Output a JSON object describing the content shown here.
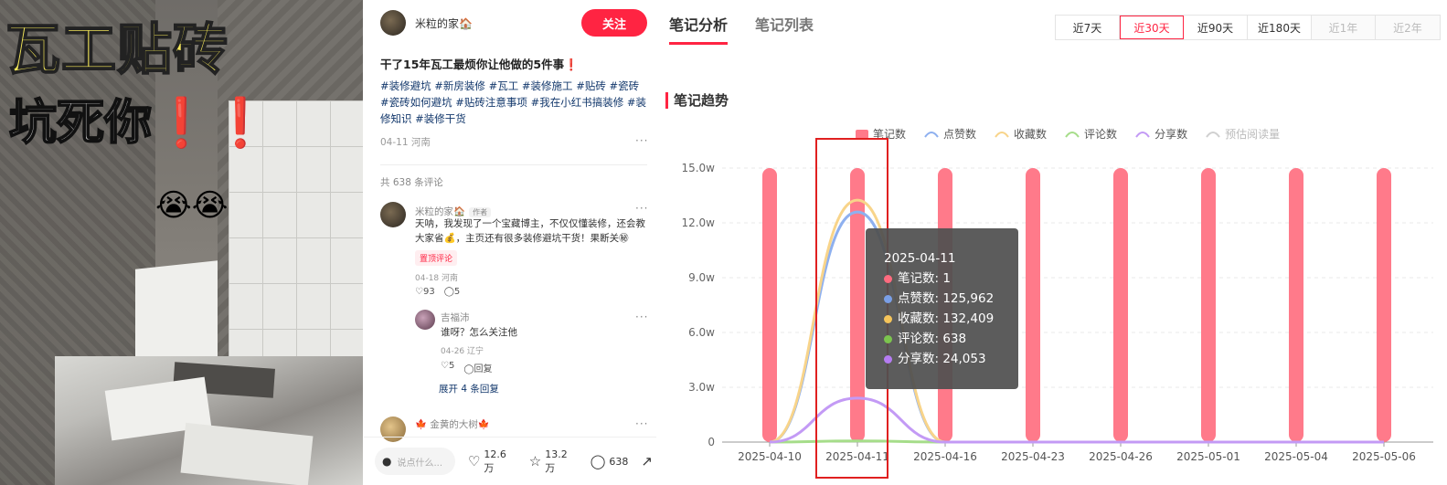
{
  "cover": {
    "title_line1": "瓦工贴砖",
    "title_line2": "坑死你",
    "title_bangs": "❗❗",
    "emoji": "😭😭"
  },
  "post": {
    "author_name": "米粒的家🏠",
    "follow_label": "关注",
    "title": "干了15年瓦工最烦你让他做的5件事❗",
    "tags": [
      "#装修避坑",
      "#新房装修",
      "#瓦工",
      "#装修施工",
      "#贴砖",
      "#瓷砖",
      "#瓷砖如何避坑",
      "#贴砖注意事项",
      "#我在小红书搞装修",
      "#装修知识",
      "#装修干货"
    ],
    "meta": "04-11 河南",
    "comment_count": "共 638 条评论",
    "comments": [
      {
        "name": "米粒的家🏠",
        "author_tag": "作者",
        "text": "天呐，我发现了一个宝藏博主，不仅仅懂装修，还会教大家省💰，主页还有很多装修避坑干货！果断关㊙",
        "pin_label": "置顶评论",
        "meta": "04-18 河南",
        "likes": "93",
        "replies": "5"
      },
      {
        "name": "吉福沛",
        "text": "谁呀？怎么关注他",
        "meta": "04-26 辽宁",
        "likes": "5",
        "reply_label": "回复"
      },
      {
        "name": "🍁 金黄的大树🍁"
      }
    ],
    "expand_label": "展开 4 条回复",
    "bottom": {
      "input_placeholder": "说点什么...",
      "likes": "12.6万",
      "collects": "13.2万",
      "comments": "638"
    }
  },
  "analytics": {
    "tabs": [
      "笔记分析",
      "笔记列表"
    ],
    "ranges": [
      "近7天",
      "近30天",
      "近90天",
      "近180天",
      "近1年",
      "近2年"
    ],
    "selected_range": "近30天",
    "section_title": "笔记趋势",
    "tooltip": {
      "date": "2025-04-11",
      "rows": [
        {
          "label": "笔记数: 1",
          "color": "#ff6b7f"
        },
        {
          "label": "点赞数: 125,962",
          "color": "#7a9fe6"
        },
        {
          "label": "收藏数: 132,409",
          "color": "#f5c45a"
        },
        {
          "label": "评论数: 638",
          "color": "#7cc44e"
        },
        {
          "label": "分享数: 24,053",
          "color": "#b57cf2"
        }
      ]
    }
  },
  "chart_data": {
    "type": "bar",
    "title": "笔记趋势",
    "categories": [
      "2025-04-10",
      "2025-04-11",
      "2025-04-16",
      "2025-04-23",
      "2025-04-26",
      "2025-05-01",
      "2025-05-04",
      "2025-05-06"
    ],
    "y_tick_labels": [
      "0",
      "3.0w",
      "6.0w",
      "9.0w",
      "12.0w",
      "15.0w"
    ],
    "ylim": [
      0,
      150000
    ],
    "grid": true,
    "legend_position": "top-center",
    "series": [
      {
        "name": "笔记数",
        "kind": "bar",
        "color": "#ff7a8a",
        "values": [
          1,
          1,
          1,
          1,
          1,
          1,
          1,
          1
        ]
      },
      {
        "name": "点赞数",
        "kind": "line",
        "color": "#8eb0ef",
        "values": [
          0,
          125962,
          0,
          0,
          0,
          0,
          0,
          0
        ]
      },
      {
        "name": "收藏数",
        "kind": "line",
        "color": "#f8d48a",
        "values": [
          0,
          132409,
          0,
          0,
          0,
          0,
          0,
          0
        ]
      },
      {
        "name": "评论数",
        "kind": "line",
        "color": "#a6dd8a",
        "values": [
          0,
          638,
          0,
          0,
          0,
          0,
          0,
          0
        ]
      },
      {
        "name": "分享数",
        "kind": "line",
        "color": "#c39af5",
        "values": [
          0,
          24053,
          0,
          0,
          0,
          0,
          0,
          0
        ]
      },
      {
        "name": "预估阅读量",
        "kind": "line",
        "color": "#d0d0d0",
        "values": [],
        "disabled": true
      }
    ]
  }
}
